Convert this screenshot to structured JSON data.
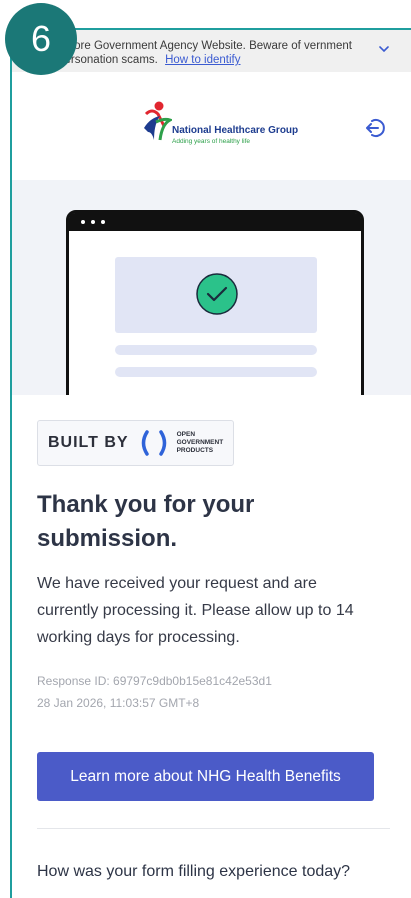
{
  "step_badge": "6",
  "gov_banner": {
    "text": "Singapore Government Agency Website. Beware of government impersonation scams.",
    "visible_text": "ingapore Government Agency Website. Beware of vernment impersonation scams.",
    "identify_link": "How to identify",
    "icon": "chevron-down-icon"
  },
  "header": {
    "logo_name": "National Healthcare Group",
    "logo_tagline": "Adding years of healthy life",
    "logout_icon": "logout-icon"
  },
  "built_by": {
    "label": "BUILT BY",
    "org_line1": "OPEN",
    "org_line2": "GOVERNMENT",
    "org_line3": "PRODUCTS"
  },
  "confirmation": {
    "title": "Thank you for your submission.",
    "body": "We have received your request and are currently processing it. Please allow up to 14 working days for processing.",
    "response_id": "Response ID: 69797c9db0b15e81c42e53d1",
    "timestamp": "28 Jan 2026, 11:03:57 GMT+8"
  },
  "cta_button": "Learn more about NHG Health Benefits",
  "feedback": {
    "question": "How was your form filling experience today?"
  },
  "colors": {
    "accent": "#4b5bc8",
    "badge": "#1b7877",
    "frame_border": "#1f9e9e",
    "success": "#2bc28a"
  }
}
